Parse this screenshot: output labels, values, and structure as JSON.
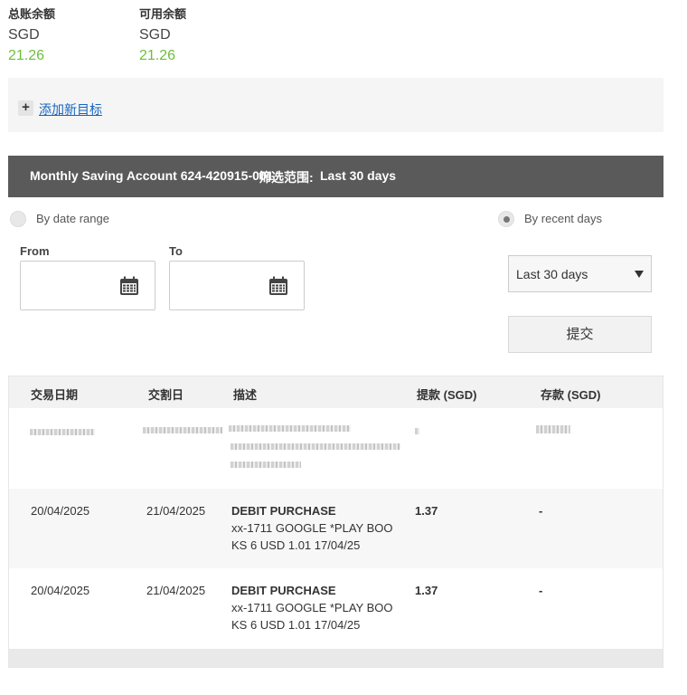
{
  "balances": {
    "total": {
      "label": "总账余额",
      "currency": "SGD",
      "amount": "21.26"
    },
    "available": {
      "label": "可用余额",
      "currency": "SGD",
      "amount": "21.26"
    }
  },
  "goal": {
    "plus": "+",
    "add_label": "添加新目标"
  },
  "account_bar": {
    "account": "Monthly Saving Account 624-420915-001",
    "filter_label": "筛选范围:",
    "filter_value": "Last 30 days"
  },
  "filters": {
    "by_date_range": "By date range",
    "by_recent_days": "By recent days",
    "from_label": "From",
    "to_label": "To",
    "selected_option": "Last 30 days",
    "submit_label": "提交"
  },
  "table": {
    "headers": [
      "交易日期",
      "交割日",
      "描述",
      "提款 (SGD)",
      "存款 (SGD)"
    ],
    "rows": [
      {
        "date": "20/04/2025",
        "settle": "21/04/2025",
        "desc1": "DEBIT PURCHASE",
        "desc2": "xx-1711 GOOGLE *PLAY BOO",
        "desc3": "KS 6 USD 1.01 17/04/25",
        "withdrawal": "1.37",
        "deposit": "-"
      },
      {
        "date": "20/04/2025",
        "settle": "21/04/2025",
        "desc1": "DEBIT PURCHASE",
        "desc2": "xx-1711 GOOGLE *PLAY BOO",
        "desc3": "KS 6 USD 1.01 17/04/25",
        "withdrawal": "1.37",
        "deposit": "-"
      }
    ]
  },
  "icons": {
    "calendar": "calendar-icon",
    "dropdown": "caret-down-icon"
  },
  "colors": {
    "amount_green": "#6cbf3a",
    "bar_gray": "#5a5a5a",
    "link_blue": "#1565c0"
  }
}
